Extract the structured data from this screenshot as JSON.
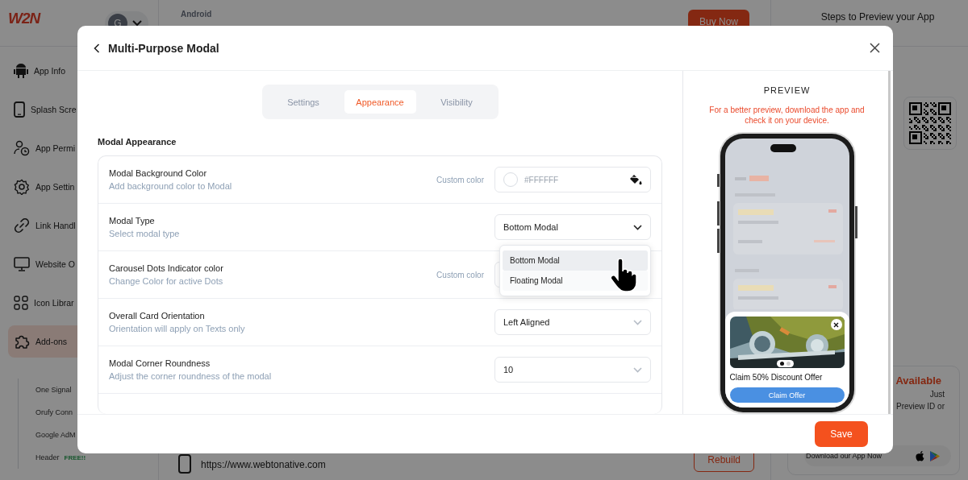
{
  "background": {
    "sidebar": {
      "logo": "W2N",
      "avatar_letter": "G",
      "items": [
        {
          "label": "App Info",
          "selected": false
        },
        {
          "label": "Splash Scre",
          "selected": false
        },
        {
          "label": "App Permi",
          "selected": false
        },
        {
          "label": "App Settin",
          "selected": false
        },
        {
          "label": "Link Handl",
          "selected": false
        },
        {
          "label": "Website O",
          "selected": false
        },
        {
          "label": "Icon Librar",
          "selected": false
        },
        {
          "label": "Add-ons",
          "selected": true
        }
      ],
      "sub_items": [
        {
          "label": "One Signal"
        },
        {
          "label": "Orufy Conn"
        },
        {
          "label": "Google AdM"
        },
        {
          "label": "Header",
          "badge": "FREE!!"
        }
      ]
    },
    "header": {
      "platform": "Android",
      "buy_button": "Buy Now"
    },
    "build": {
      "url": "https://www.webtonative.com",
      "button": "Rebuild"
    },
    "right_panel": {
      "title": "Steps to Preview your App",
      "card_heading": "Available",
      "card_lines": [
        "Just",
        "Preview ID or"
      ],
      "download": "Download our App Now"
    }
  },
  "modal": {
    "title": "Multi-Purpose Modal",
    "tabs": [
      {
        "label": "Settings",
        "selected": false
      },
      {
        "label": "Appearance",
        "selected": true
      },
      {
        "label": "Visibility",
        "selected": false
      }
    ],
    "section_title": "Modal Appearance",
    "rows": [
      {
        "kind": "color",
        "title": "Modal Background Color",
        "subtitle": "Add background color to Modal",
        "color_label": "Custom color",
        "value": "#FFFFFF"
      },
      {
        "kind": "select",
        "title": "Modal Type",
        "subtitle": "Select modal type",
        "value": "Bottom Modal",
        "expanded": true,
        "options": [
          {
            "label": "Bottom Modal",
            "selected": true
          },
          {
            "label": "Floating Modal",
            "selected": false
          }
        ]
      },
      {
        "kind": "color",
        "title": "Carousel Dots Indicator color",
        "subtitle": "Change Color for active Dots",
        "color_label": "Custom color"
      },
      {
        "kind": "select",
        "title": "Overall Card Orientation",
        "subtitle": "Orientation will apply on Texts only",
        "value": "Left Aligned",
        "expanded": false
      },
      {
        "kind": "select",
        "title": "Modal Corner Roundness",
        "subtitle": "Adjust the corner roundness of the modal",
        "value": "10",
        "expanded": false
      }
    ],
    "preview": {
      "heading": "PREVIEW",
      "note": "For a better preview, download the app and check it on your device.",
      "popup": {
        "kind": "picture",
        "dots": [
          {
            "selected": true
          },
          {
            "selected": false
          }
        ],
        "title": "Claim 50% Discount Offer",
        "button": "Claim Offer"
      }
    },
    "save_button": "Save"
  }
}
